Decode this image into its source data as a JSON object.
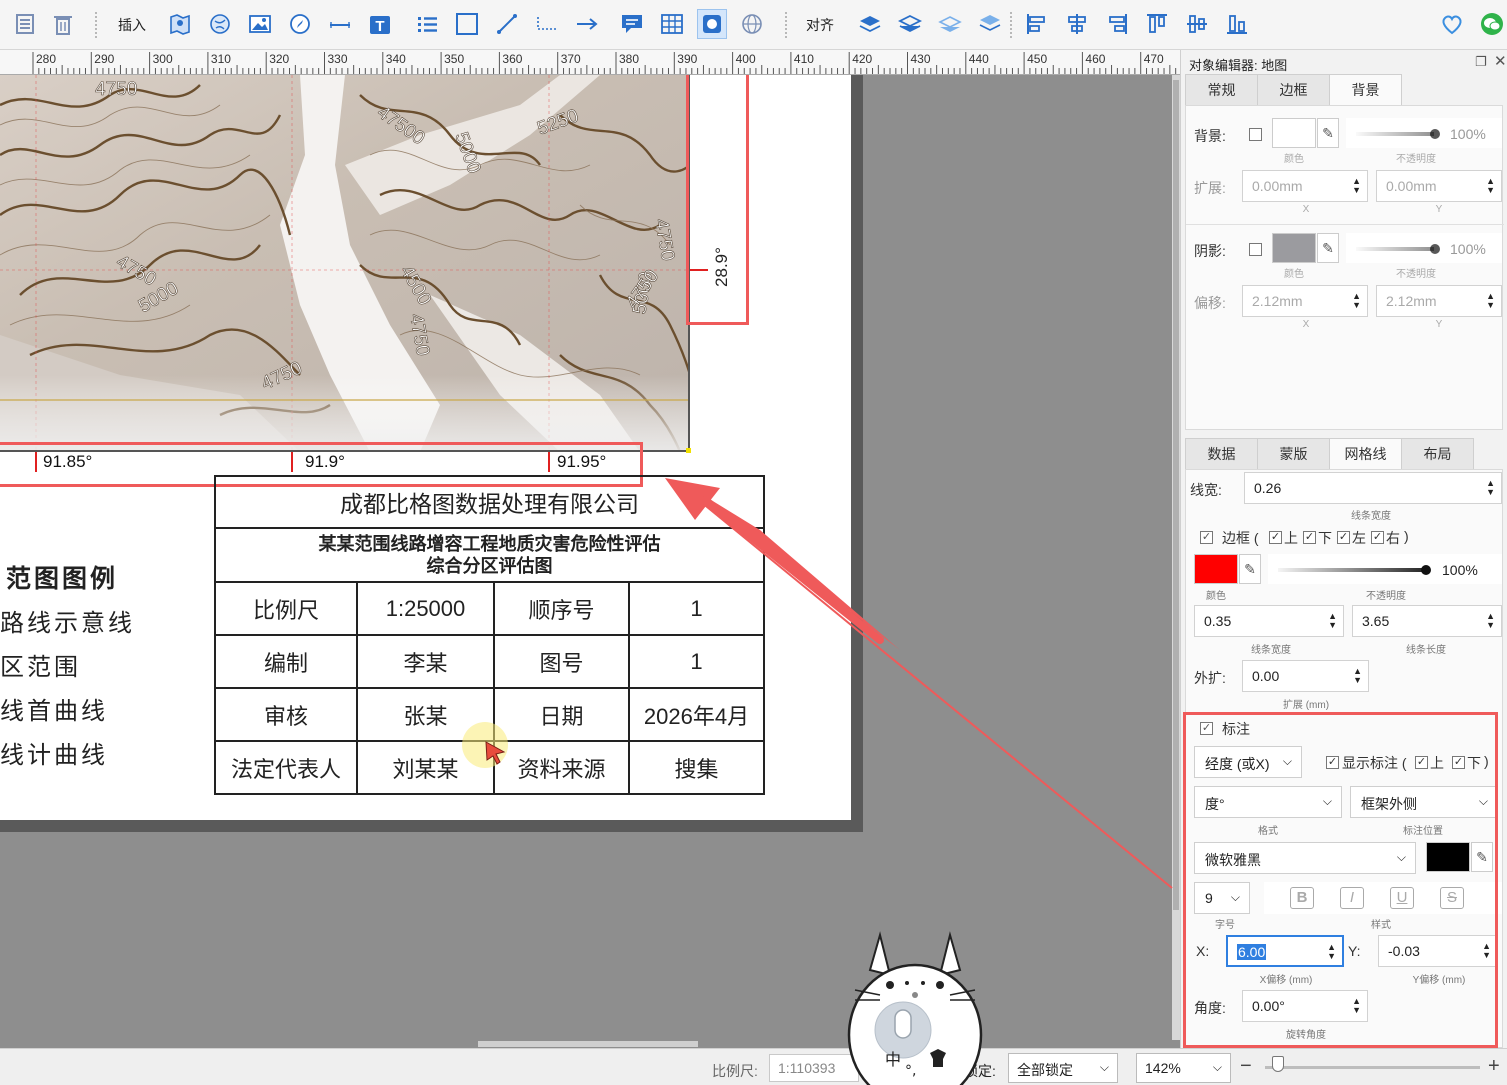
{
  "toolbar": {
    "insert_label": "插入",
    "align_label": "对齐"
  },
  "ruler": {
    "ticks": [
      "280",
      "290",
      "300",
      "310",
      "320",
      "330",
      "340",
      "350",
      "360",
      "370",
      "380",
      "390",
      "400",
      "410",
      "420",
      "430",
      "440",
      "450",
      "460",
      "470"
    ]
  },
  "map": {
    "contour_labels": [
      "4750",
      "47500",
      "5000",
      "5250",
      "4750",
      "5000",
      "4500",
      "4750",
      "4750",
      "4750",
      "5000",
      "4750"
    ],
    "lon_labels": [
      "91.85°",
      "91.9°",
      "91.95°"
    ],
    "lat_label": "28.9°"
  },
  "legend": {
    "title": "范图图例",
    "items": [
      "路线示意线",
      "区范围",
      "线首曲线",
      "线计曲线"
    ]
  },
  "title_block": {
    "company": "成都比格图数据处理有限公司",
    "project_line1": "某某范围线路增容工程地质灾害危险性评估",
    "project_line2": "综合分区评估图",
    "rows": [
      [
        "比例尺",
        "1:25000",
        "顺序号",
        "1"
      ],
      [
        "编制",
        "李某",
        "图号",
        "1"
      ],
      [
        "审核",
        "张某",
        "日期",
        "2026年4月"
      ],
      [
        "法定代表人",
        "刘某某",
        "资料来源",
        "搜集"
      ]
    ]
  },
  "status": {
    "scale_label": "比例尺:",
    "scale_value": "1:110393",
    "lock_label": "图锁定:",
    "lock_value": "全部锁定",
    "zoom_value": "142%",
    "minus": "−",
    "plus": "+"
  },
  "panel": {
    "title": "对象编辑器: 地图",
    "top_tabs": [
      "常规",
      "边框",
      "背景"
    ],
    "background": {
      "bg_label": "背景:",
      "color_sub": "颜色",
      "opacity_sub": "不透明度",
      "opacity_value": "100%",
      "extend_label": "扩展:",
      "extend_x": "0.00mm",
      "extend_y": "0.00mm",
      "x_sub": "X",
      "y_sub": "Y",
      "shadow_label": "阴影:",
      "shadow_opacity": "100%",
      "offset_label": "偏移:",
      "offset_x": "2.12mm",
      "offset_y": "2.12mm",
      "shadow_color": "#9b9b9f"
    },
    "bottom_tabs": [
      "数据",
      "蒙版",
      "网格线",
      "布局"
    ],
    "grid": {
      "width_label": "线宽:",
      "width_value": "0.26",
      "width_sub": "线条宽度",
      "border_label": "边框 (",
      "border_sides": [
        "上",
        "下",
        "左",
        "右"
      ],
      "border_close": ")",
      "color": "#ff0000",
      "color_sub": "颜色",
      "opacity_value": "100%",
      "opacity_sub": "不透明度",
      "line_width": "0.35",
      "line_width_sub": "线条宽度",
      "line_length": "3.65",
      "line_length_sub": "线条长度",
      "expand_label": "外扩:",
      "expand_value": "0.00",
      "expand_sub": "扩展 (mm)"
    },
    "annotation": {
      "label": "标注",
      "axis_select": "经度 (或X)",
      "show_label": "显示标注 (",
      "show_sides": [
        "上",
        "下"
      ],
      "show_close": ")",
      "format_select": "度°",
      "format_sub": "格式",
      "position_select": "框架外侧",
      "position_sub": "标注位置",
      "font_select": "微软雅黑",
      "font_color": "#000000",
      "size_select": "9",
      "size_sub": "字号",
      "style_sub": "样式",
      "style_buttons": [
        "B",
        "I",
        "U",
        "S"
      ],
      "x_label": "X:",
      "x_value": "6.00",
      "x_sub": "X偏移 (mm)",
      "y_label": "Y:",
      "y_value": "-0.03",
      "y_sub": "Y偏移 (mm)",
      "angle_label": "角度:",
      "angle_value": "0.00°",
      "angle_sub": "旋转角度"
    }
  },
  "colors": {
    "highlight": "#ef5a5a",
    "accent": "#2a6fc9"
  }
}
